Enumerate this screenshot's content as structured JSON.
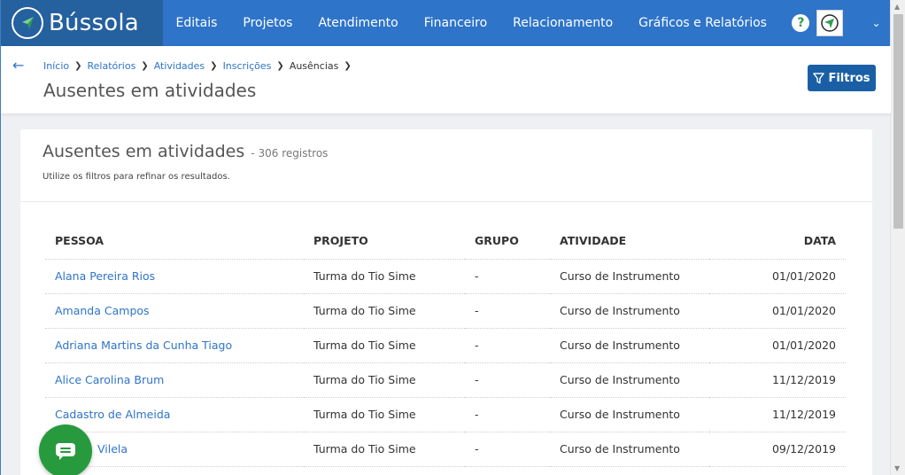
{
  "brand": {
    "name": "Bússola"
  },
  "nav": [
    "Editais",
    "Projetos",
    "Atendimento",
    "Financeiro",
    "Relacionamento",
    "Gráficos e Relatórios"
  ],
  "header": {
    "breadcrumb": [
      "Início",
      "Relatórios",
      "Atividades",
      "Inscrições"
    ],
    "breadcrumb_current": "Ausências",
    "title": "Ausentes em atividades",
    "filters_label": "Filtros"
  },
  "card": {
    "title": "Ausentes em atividades",
    "count": "- 306 registros",
    "subtitle": "Utilize os filtros para refinar os resultados."
  },
  "table": {
    "columns": [
      "PESSOA",
      "PROJETO",
      "GRUPO",
      "ATIVIDADE",
      "DATA"
    ],
    "rows": [
      [
        "Alana Pereira Rios",
        "Turma do Tio Sime",
        "-",
        "Curso de Instrumento",
        "01/01/2020"
      ],
      [
        "Amanda Campos",
        "Turma do Tio Sime",
        "-",
        "Curso de Instrumento",
        "01/01/2020"
      ],
      [
        "Adriana Martins da Cunha Tiago",
        "Turma do Tio Sime",
        "-",
        "Curso de Instrumento",
        "01/01/2020"
      ],
      [
        "Alice Carolina Brum",
        "Turma do Tio Sime",
        "-",
        "Curso de Instrumento",
        "11/12/2019"
      ],
      [
        "Cadastro de Almeida",
        "Turma do Tio Sime",
        "-",
        "Curso de Instrumento",
        "11/12/2019"
      ],
      [
        "Vilela",
        "Turma do Tio Sime",
        "-",
        "Curso de Instrumento",
        "09/12/2019"
      ]
    ]
  },
  "colors": {
    "nav_bg": "#2e74c9",
    "brand_bg": "#25609f",
    "link": "#2e74c9",
    "filters_btn": "#1a5fa6",
    "chat_fab": "#279a3e"
  },
  "icons": {
    "brand": "compass-icon",
    "help": "help-icon",
    "back": "back-arrow-icon",
    "filter": "filter-icon",
    "chat": "chat-icon"
  }
}
